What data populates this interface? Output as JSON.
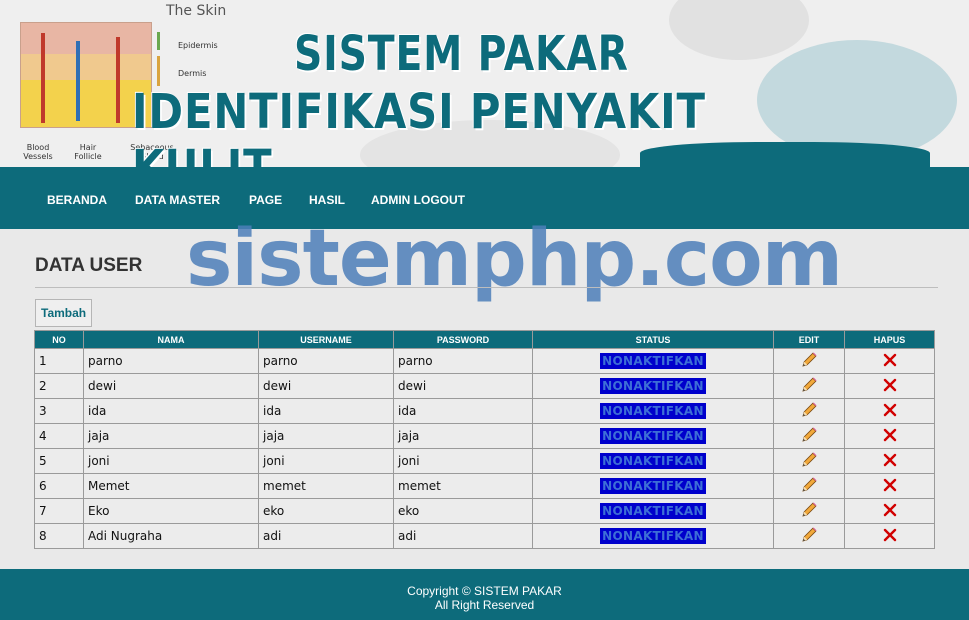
{
  "header": {
    "skin_title": "The Skin",
    "skin_labels": {
      "epidermis": "Epidermis",
      "dermis": "Dermis",
      "blood_vessels": "Blood Vessels",
      "hair_follicle": "Hair Follicle",
      "sebaceous_gland": "Sebaceous Gland"
    },
    "title_line1": "SISTEM PAKAR",
    "title_line2": "IDENTIFIKASI PENYAKIT KULIT"
  },
  "nav": {
    "items": [
      "BERANDA",
      "DATA MASTER",
      "PAGE",
      "HASIL",
      "ADMIN LOGOUT"
    ]
  },
  "main": {
    "page_title": "DATA USER",
    "watermark": "sistemphp.com",
    "add_button": "Tambah",
    "table": {
      "headers": [
        "NO",
        "NAMA",
        "USERNAME",
        "PASSWORD",
        "STATUS",
        "EDIT",
        "HAPUS"
      ],
      "rows": [
        {
          "no": "1",
          "nama": "parno",
          "username": "parno",
          "password": "parno",
          "status": "NONAKTIFKAN"
        },
        {
          "no": "2",
          "nama": "dewi",
          "username": "dewi",
          "password": "dewi",
          "status": "NONAKTIFKAN"
        },
        {
          "no": "3",
          "nama": "ida",
          "username": "ida",
          "password": "ida",
          "status": "NONAKTIFKAN"
        },
        {
          "no": "4",
          "nama": "jaja",
          "username": "jaja",
          "password": "jaja",
          "status": "NONAKTIFKAN"
        },
        {
          "no": "5",
          "nama": "joni",
          "username": "joni",
          "password": "joni",
          "status": "NONAKTIFKAN"
        },
        {
          "no": "6",
          "nama": "Memet",
          "username": "memet",
          "password": "memet",
          "status": "NONAKTIFKAN"
        },
        {
          "no": "7",
          "nama": "Eko",
          "username": "eko",
          "password": "eko",
          "status": "NONAKTIFKAN"
        },
        {
          "no": "8",
          "nama": "Adi Nugraha",
          "username": "adi",
          "password": "adi",
          "status": "NONAKTIFKAN"
        }
      ],
      "edit_icon": "pencil-icon",
      "delete_icon": "close-icon"
    }
  },
  "footer": {
    "copyright": "Copyright © SISTEM PAKAR",
    "rights": "All Right Reserved"
  },
  "colors": {
    "primary": "#0d6b7b",
    "status_bg": "#0000cc",
    "status_text": "#3d6fd6",
    "watermark": "#4d7fba"
  }
}
